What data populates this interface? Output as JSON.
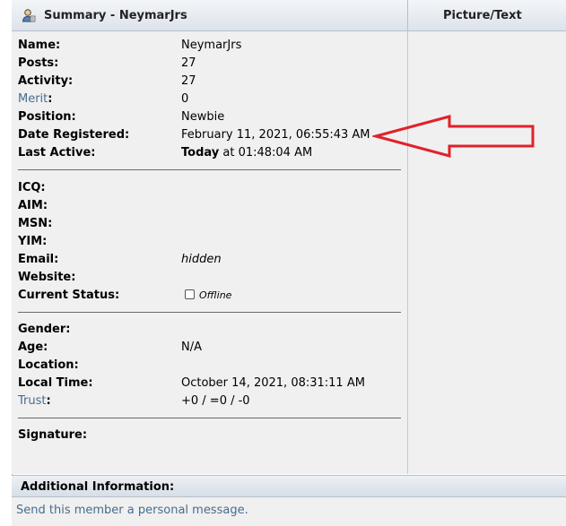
{
  "header": {
    "summary_title": "Summary - NeymarJrs",
    "picture_title": "Picture/Text"
  },
  "profile": {
    "name_label": "Name:",
    "name_value": "NeymarJrs",
    "posts_label": "Posts:",
    "posts_value": "27",
    "activity_label": "Activity:",
    "activity_value": "27",
    "merit_label": "Merit",
    "merit_colon": ":",
    "merit_value": "0",
    "position_label": "Position:",
    "position_value": "Newbie",
    "registered_label": "Date Registered:",
    "registered_value": "February 11, 2021, 06:55:43 AM",
    "last_active_label": "Last Active:",
    "last_active_today": "Today",
    "last_active_rest": " at 01:48:04 AM"
  },
  "contact": {
    "icq_label": "ICQ:",
    "aim_label": "AIM:",
    "msn_label": "MSN:",
    "yim_label": "YIM:",
    "email_label": "Email:",
    "email_value": "hidden",
    "website_label": "Website:",
    "status_label": "Current Status:",
    "status_value": "Offline"
  },
  "personal": {
    "gender_label": "Gender:",
    "age_label": "Age:",
    "age_value": "N/A",
    "location_label": "Location:",
    "local_time_label": "Local Time:",
    "local_time_value": "October 14, 2021, 08:31:11 AM",
    "trust_label": "Trust",
    "trust_colon": ":",
    "trust_value": "+0 / =0 / -0"
  },
  "signature": {
    "label": "Signature:"
  },
  "additional": {
    "title": "Additional Information:",
    "pm_link": "Send this member a personal message."
  },
  "colors": {
    "link": "#476c8e",
    "annotation_arrow": "#e0222a",
    "panel_bg": "#f0f0f0"
  }
}
